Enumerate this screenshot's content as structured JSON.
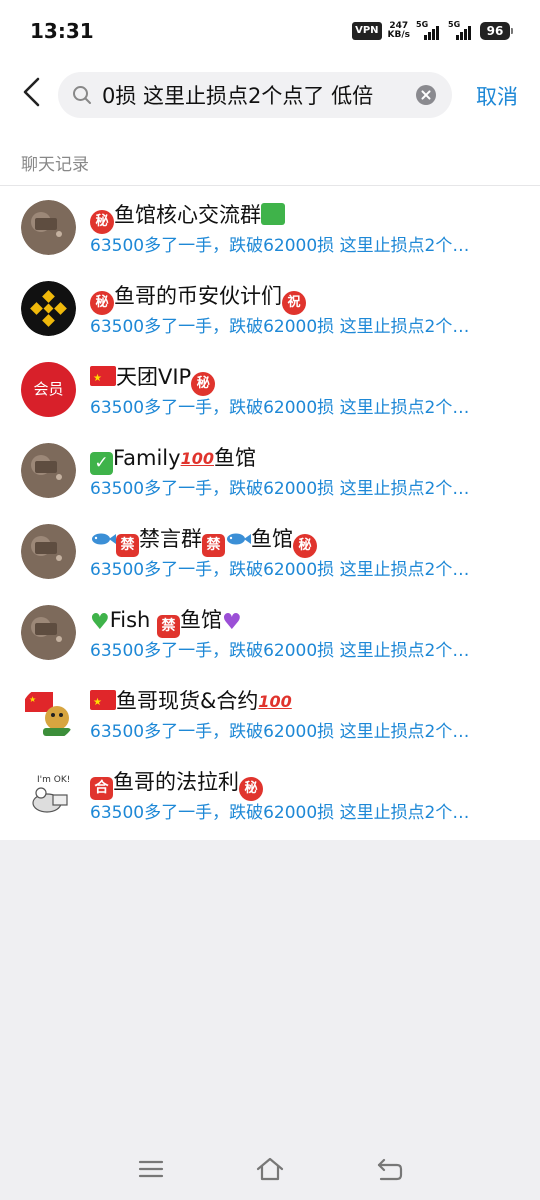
{
  "status_bar": {
    "time": "13:31",
    "vpn": "VPN",
    "net_speed_value": "247",
    "net_speed_unit": "KB/s",
    "sim1_label": "5G",
    "sim2_label": "5G",
    "battery": "96"
  },
  "search": {
    "query": "0损 这里止损点2个点了 低倍",
    "cancel_label": "取消"
  },
  "section_title": "聊天记录",
  "snippet_text": "63500多了一手，跌破62000损 这里止损点2个…",
  "results": [
    {
      "title_main": "鱼馆核心交流群",
      "prefix_icon": "secret-emoji",
      "suffix_icon": "chart-emoji",
      "snippet": "63500多了一手，跌破62000损 这里止损点2个…"
    },
    {
      "title_main": "鱼哥的币安伙计们",
      "prefix_icon": "secret-emoji",
      "suffix_icon": "congratulations-emoji",
      "snippet": "63500多了一手，跌破62000损 这里止损点2个…"
    },
    {
      "title_main": "天团VIP",
      "prefix_icon": "china-flag",
      "suffix_icon": "secret-emoji",
      "avatar_text": "会员",
      "snippet": "63500多了一手，跌破62000损 这里止损点2个…"
    },
    {
      "title_main": "Family",
      "title_tail": "鱼馆",
      "prefix_icon": "check-mark",
      "mid_icon": "hundred-points",
      "snippet": "63500多了一手，跌破62000损 这里止损点2个…"
    },
    {
      "title_main": "禁言群",
      "title_tail": "鱼馆",
      "prefix_icon": "fish-emoji",
      "snippet": "63500多了一手，跌破62000损 这里止损点2个…"
    },
    {
      "title_main": "Fish ",
      "title_tail": "鱼馆",
      "prefix_icon": "green-heart",
      "suffix_icon": "purple-heart",
      "snippet": "63500多了一手，跌破62000损 这里止损点2个…"
    },
    {
      "title_main": "鱼哥现货&合约",
      "prefix_icon": "china-flag",
      "suffix_icon": "hundred-points",
      "snippet": "63500多了一手，跌破62000损 这里止损点2个…"
    },
    {
      "title_main": "鱼哥的法拉利",
      "prefix_icon": "passing-grade-emoji",
      "suffix_icon": "secret-emoji",
      "avatar_text": "I'm OK!",
      "snippet": "63500多了一手，跌破62000损 这里止损点2个…"
    }
  ],
  "emoji_glyphs": {
    "secret": "秘",
    "congrats": "祝",
    "forbidden": "禁",
    "passing": "合",
    "check": "✓",
    "hundred": "100"
  },
  "colors": {
    "accent_blue": "#1e88d6",
    "emoji_red": "#e0342d",
    "background": "#efeff2"
  }
}
